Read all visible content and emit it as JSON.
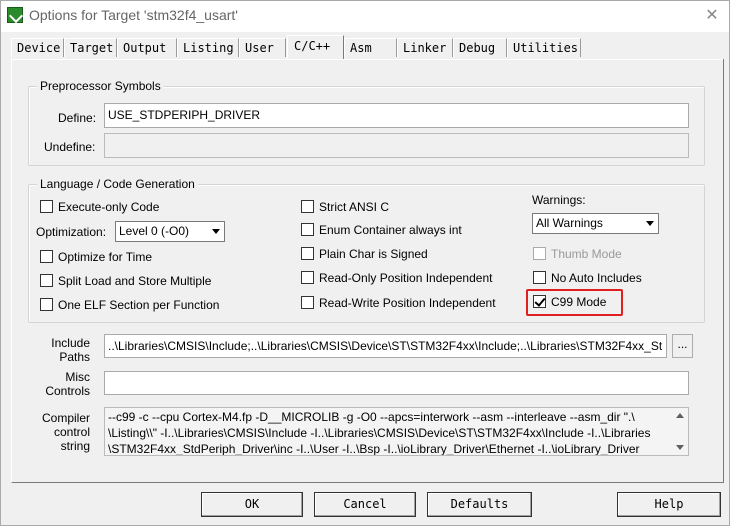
{
  "window": {
    "title": "Options for Target 'stm32f4_usart'",
    "close_glyph": "✕"
  },
  "tabs": [
    {
      "label": "Device"
    },
    {
      "label": "Target"
    },
    {
      "label": "Output"
    },
    {
      "label": "Listing"
    },
    {
      "label": "User"
    },
    {
      "label": "C/C++",
      "active": true
    },
    {
      "label": "Asm"
    },
    {
      "label": "Linker"
    },
    {
      "label": "Debug"
    },
    {
      "label": "Utilities"
    }
  ],
  "preprocessor": {
    "title": "Preprocessor Symbols",
    "define_label": "Define:",
    "define_value": "USE_STDPERIPH_DRIVER",
    "undefine_label": "Undefine:",
    "undefine_value": ""
  },
  "language": {
    "title": "Language / Code Generation",
    "execute_only": {
      "label": "Execute-only Code",
      "checked": false
    },
    "optimization_label": "Optimization:",
    "optimization_value": "Level 0 (-O0)",
    "optimize_time": {
      "label": "Optimize for Time",
      "checked": false
    },
    "split_load": {
      "label": "Split Load and Store Multiple",
      "checked": false
    },
    "one_elf": {
      "label": "One ELF Section per Function",
      "checked": false
    },
    "strict_ansi": {
      "label": "Strict ANSI C",
      "checked": false
    },
    "enum_container": {
      "label": "Enum Container always int",
      "checked": false
    },
    "plain_char": {
      "label": "Plain Char is Signed",
      "checked": false
    },
    "ro_pos": {
      "label": "Read-Only Position Independent",
      "checked": false
    },
    "rw_pos": {
      "label": "Read-Write Position Independent",
      "checked": false
    },
    "warnings_label": "Warnings:",
    "warnings_value": "All Warnings",
    "thumb_mode": {
      "label": "Thumb Mode",
      "checked": false,
      "disabled": true
    },
    "no_auto_includes": {
      "label": "No Auto Includes",
      "checked": false
    },
    "c99_mode": {
      "label": "C99 Mode",
      "checked": true
    }
  },
  "include_paths": {
    "label_line1": "Include",
    "label_line2": "Paths",
    "value": "..\\Libraries\\CMSIS\\Include;..\\Libraries\\CMSIS\\Device\\ST\\STM32F4xx\\Include;..\\Libraries\\STM32F4xx_St",
    "browse_label": "..."
  },
  "misc_controls": {
    "label_line1": "Misc",
    "label_line2": "Controls",
    "value": ""
  },
  "compiler_control": {
    "label_line1": "Compiler",
    "label_line2": "control",
    "label_line3": "string",
    "line1": "--c99 -c --cpu Cortex-M4.fp -D__MICROLIB -g -O0 --apcs=interwork --asm --interleave --asm_dir \".\\",
    "line2": "\\Listing\\\\\" -I..\\Libraries\\CMSIS\\Include -I..\\Libraries\\CMSIS\\Device\\ST\\STM32F4xx\\Include -I..\\Libraries",
    "line3": "\\STM32F4xx_StdPeriph_Driver\\inc -I..\\User -I..\\Bsp -I..\\ioLibrary_Driver\\Ethernet -I..\\ioLibrary_Driver"
  },
  "buttons": {
    "ok": "OK",
    "cancel": "Cancel",
    "defaults": "Defaults",
    "help": "Help"
  },
  "colors": {
    "highlight": "#e02020",
    "app_icon": "#2b8a2b",
    "dialog_bg": "#f0f0f0"
  },
  "icons": {
    "app": "keil-uvision-icon",
    "close": "close-icon",
    "dropdown": "chevron-down-icon"
  }
}
